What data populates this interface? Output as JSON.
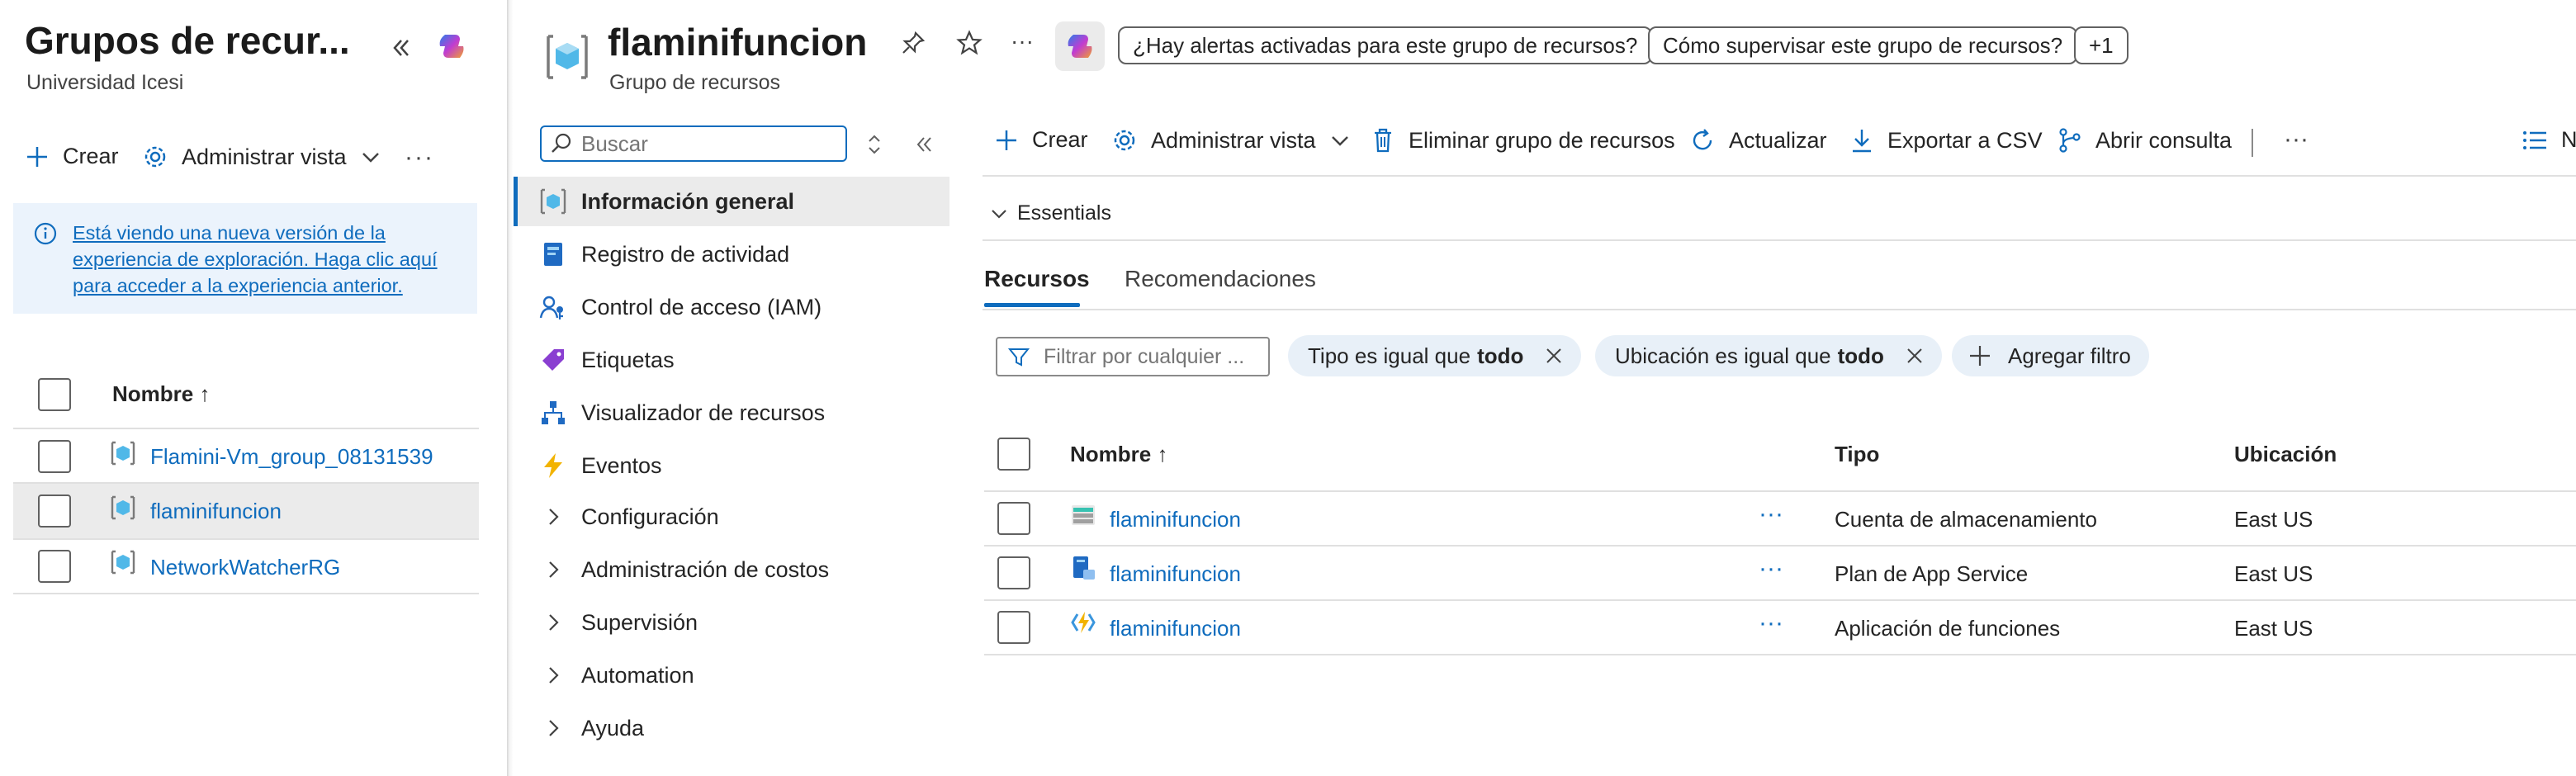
{
  "left_panel": {
    "title": "Grupos de recur...",
    "subtitle": "Universidad Icesi",
    "toolbar": {
      "create_label": "Crear",
      "manage_view_label": "Administrar vista"
    },
    "info_banner": "Está viendo una nueva versión de la experiencia de exploración. Haga clic aquí para acceder a la experiencia anterior.",
    "table_header": "Nombre ↑",
    "rows": [
      {
        "name": "Flamini-Vm_group_08131539"
      },
      {
        "name": "flaminifuncion"
      },
      {
        "name": "NetworkWatcherRG"
      }
    ]
  },
  "resource": {
    "title": "flaminifuncion",
    "subtitle": "Grupo de recursos",
    "prompts": [
      "¿Hay alertas activadas para este grupo de recursos?",
      "Cómo supervisar este grupo de recursos?",
      "+1"
    ]
  },
  "nav": {
    "search_placeholder": "Buscar",
    "items": [
      {
        "label": "Información general",
        "icon": "overview-icon"
      },
      {
        "label": "Registro de actividad",
        "icon": "activity-log-icon"
      },
      {
        "label": "Control de acceso (IAM)",
        "icon": "iam-icon"
      },
      {
        "label": "Etiquetas",
        "icon": "tag-icon"
      },
      {
        "label": "Visualizador de recursos",
        "icon": "resource-visualizer-icon"
      },
      {
        "label": "Eventos",
        "icon": "lightning-icon"
      },
      {
        "label": "Configuración",
        "icon": "chevron-right-icon"
      },
      {
        "label": "Administración de costos",
        "icon": "chevron-right-icon"
      },
      {
        "label": "Supervisión",
        "icon": "chevron-right-icon"
      },
      {
        "label": "Automation",
        "icon": "chevron-right-icon"
      },
      {
        "label": "Ayuda",
        "icon": "chevron-right-icon"
      }
    ]
  },
  "main": {
    "toolbar": {
      "create": "Crear",
      "manage_view": "Administrar vista",
      "delete": "Eliminar grupo de recursos",
      "refresh": "Actualizar",
      "export": "Exportar a CSV",
      "query": "Abrir consulta",
      "cut_label": "N"
    },
    "essentials": "Essentials",
    "tabs": [
      "Recursos",
      "Recomendaciones"
    ],
    "filter_placeholder": "Filtrar por cualquier ...",
    "filters": [
      {
        "prefix": "Tipo es igual que",
        "value": "todo"
      },
      {
        "prefix": "Ubicación es igual que",
        "value": "todo"
      }
    ],
    "add_filter": "Agregar filtro",
    "columns": [
      "Nombre ↑",
      "Tipo",
      "Ubicación"
    ],
    "rows": [
      {
        "name": "flaminifuncion",
        "type": "Cuenta de almacenamiento",
        "location": "East US",
        "icon": "storage-account-icon"
      },
      {
        "name": "flaminifuncion",
        "type": "Plan de App Service",
        "location": "East US",
        "icon": "app-service-plan-icon"
      },
      {
        "name": "flaminifuncion",
        "type": "Aplicación de funciones",
        "location": "East US",
        "icon": "function-app-icon"
      }
    ]
  },
  "colors": {
    "accent": "#0f6cbd",
    "selected_bg": "#ebebeb",
    "banner_bg": "#ebf3fc"
  }
}
